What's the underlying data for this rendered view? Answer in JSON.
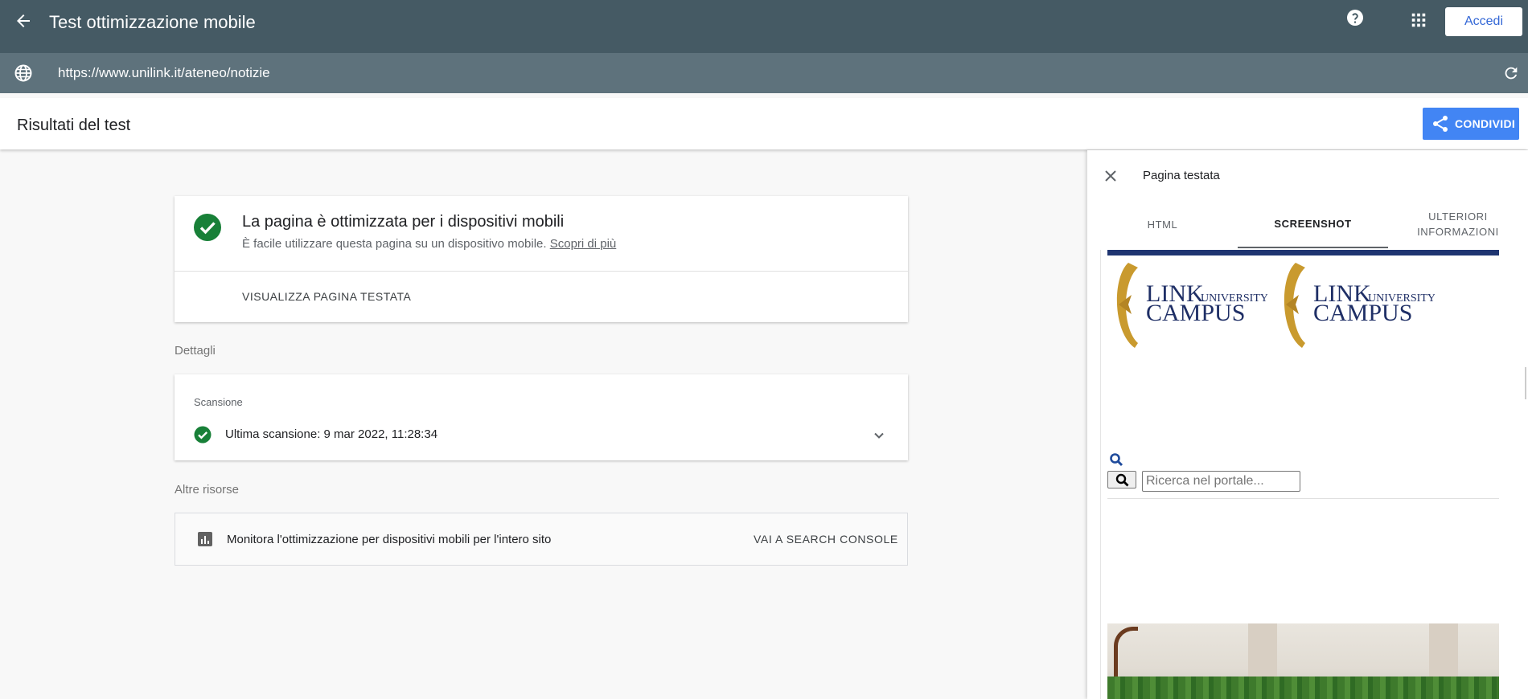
{
  "header": {
    "title": "Test ottimizzazione mobile",
    "signin_label": "Accedi",
    "icons": {
      "back": "arrow-left-icon",
      "help": "help-circle-icon",
      "apps": "apps-grid-icon"
    }
  },
  "urlbar": {
    "url": "https://www.unilink.it/ateneo/notizie",
    "icons": {
      "globe": "globe-icon",
      "refresh": "refresh-icon"
    }
  },
  "results": {
    "title": "Risultati del test",
    "share_label": "CONDIVIDI"
  },
  "result_card": {
    "heading": "La pagina è ottimizzata per i dispositivi mobili",
    "subtitle": "È facile utilizzare questa pagina su un dispositivo mobile.",
    "learn_more": "Scopri di più",
    "view_page": "VISUALIZZA PAGINA TESTATA",
    "status_color": "#188038"
  },
  "details": {
    "label": "Dettagli",
    "scan_label": "Scansione",
    "last_scan": "Ultima scansione: 9 mar 2022, 11:28:34"
  },
  "resources": {
    "label": "Altre risorse",
    "monitor_text": "Monitora l'ottimizzazione per dispositivi mobili per l'intero sito",
    "console_link": "VAI A SEARCH CONSOLE"
  },
  "side_panel": {
    "title": "Pagina testata",
    "tabs": [
      {
        "label": "HTML",
        "active": false
      },
      {
        "label": "SCREENSHOT",
        "active": true
      },
      {
        "label": "ULTERIORI INFORMAZIONI",
        "active": false
      }
    ],
    "screenshot": {
      "search_placeholder": "Ricerca nel portale...",
      "accent": "#1f3571",
      "logo_gold": "#c99a2e",
      "logo_text_color": "#1f2f66"
    }
  },
  "colors": {
    "header": "#455a64",
    "urlbar": "#5e727c",
    "share": "#4285f4"
  }
}
